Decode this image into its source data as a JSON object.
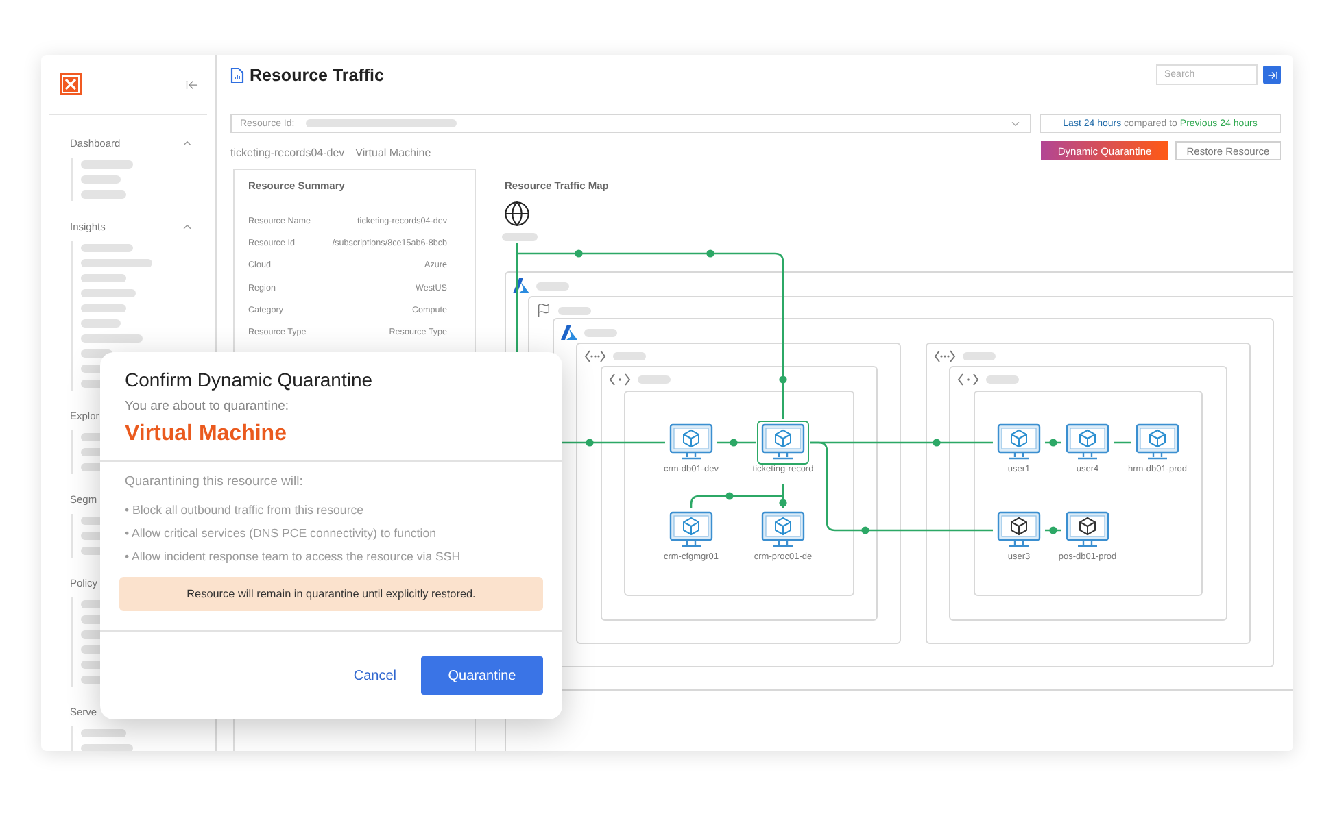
{
  "sidebar": {
    "sections": [
      {
        "label": "Dashboard",
        "expanded": true
      },
      {
        "label": "Insights",
        "expanded": true
      },
      {
        "label": "Explor"
      },
      {
        "label": "Segm"
      },
      {
        "label": "Policy"
      },
      {
        "label": "Serve"
      }
    ]
  },
  "header": {
    "title": "Resource Traffic",
    "search": {
      "placeholder": "Search"
    }
  },
  "filter": {
    "label": "Resource Id:",
    "time_range": {
      "range": "Last 24 hours",
      "connector": "compared to",
      "baseline": "Previous 24 hours"
    }
  },
  "resource": {
    "name": "ticketing-records04-dev",
    "type": "Virtual Machine"
  },
  "actions": [
    {
      "label": "Dynamic Quarantine",
      "kind": "primary"
    },
    {
      "label": "Restore Resource",
      "kind": "secondary"
    }
  ],
  "summary": {
    "title": "Resource Summary",
    "rows": [
      {
        "label": "Resource Name",
        "value": "ticketing-records04-dev"
      },
      {
        "label": "Resource Id",
        "value": "/subscriptions/8ce15ab6-8bcb"
      },
      {
        "label": "Cloud",
        "value": "Azure"
      },
      {
        "label": "Region",
        "value": "WestUS"
      },
      {
        "label": "Category",
        "value": "Compute"
      },
      {
        "label": "Resource Type",
        "value": "Resource Type"
      }
    ]
  },
  "map": {
    "title": "Resource Traffic Map",
    "groups": [
      {
        "kind": "cloud"
      },
      {
        "kind": "region"
      },
      {
        "kind": "cloud"
      },
      {
        "kind": "vnet"
      },
      {
        "kind": "subnet"
      },
      {
        "kind": "zone"
      },
      {
        "kind": "vnet"
      },
      {
        "kind": "subnet"
      },
      {
        "kind": "zone"
      }
    ],
    "nodes": [
      {
        "label": "crm-db01-dev",
        "kind": "active",
        "selected": false
      },
      {
        "label": "ticketing-record",
        "kind": "active",
        "selected": true
      },
      {
        "label": "user1",
        "kind": "active",
        "selected": false
      },
      {
        "label": "user4",
        "kind": "active",
        "selected": false
      },
      {
        "label": "hrm-db01-prod",
        "kind": "active",
        "selected": false
      },
      {
        "label": "crm-cfgmgr01",
        "kind": "active",
        "selected": false
      },
      {
        "label": "crm-proc01-de",
        "kind": "active",
        "selected": false
      },
      {
        "label": "user3",
        "kind": "inactive",
        "selected": false
      },
      {
        "label": "pos-db01-prod",
        "kind": "inactive",
        "selected": false
      }
    ]
  },
  "modal": {
    "title": "Confirm Dynamic Quarantine",
    "intro": "You are about to quarantine:",
    "target": "Virtual Machine",
    "effects_heading": "Quarantining this resource will:",
    "effects": [
      "• Block all outbound traffic from this resource",
      "• Allow critical services (DNS PCE connectivity) to function",
      "• Allow incident response team to access the resource via SSH"
    ],
    "notice": "Resource will remain in quarantine until explicitly restored.",
    "buttons": [
      {
        "label": "Cancel",
        "kind": "link"
      },
      {
        "label": "Quarantine",
        "kind": "primary"
      }
    ]
  }
}
